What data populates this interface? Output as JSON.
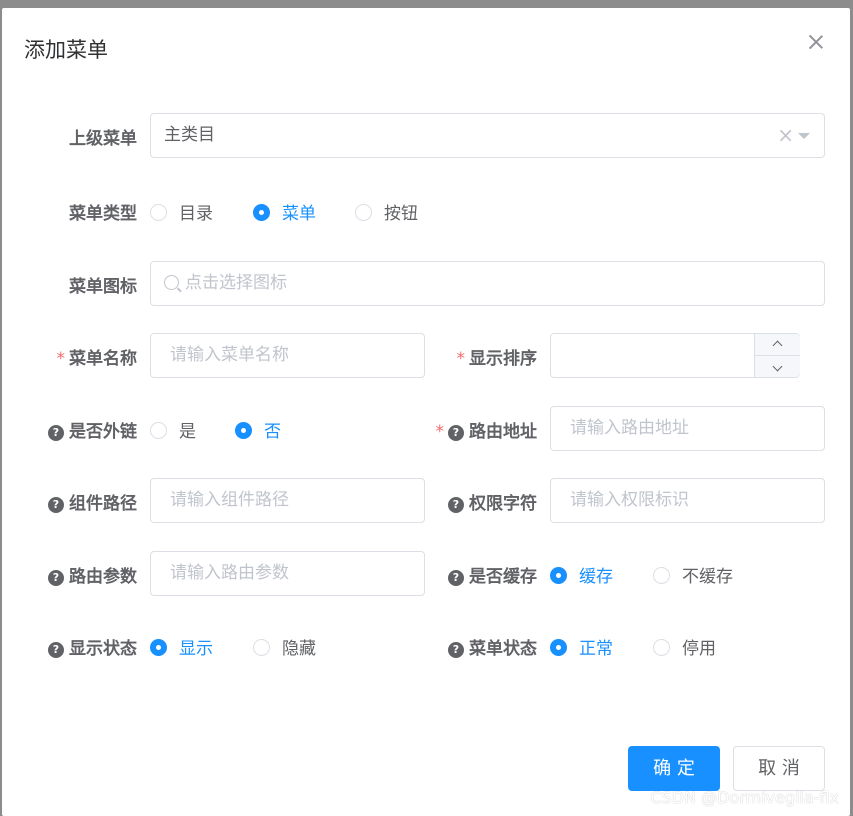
{
  "dialog": {
    "title": "添加菜单"
  },
  "parent_menu": {
    "label": "上级菜单",
    "value": "主类目",
    "clear_icon": "×",
    "arrow_icon": "caret-down"
  },
  "menu_type": {
    "label": "菜单类型",
    "options": [
      "目录",
      "菜单",
      "按钮"
    ],
    "selected": "菜单"
  },
  "menu_icon": {
    "label": "菜单图标",
    "placeholder": "点击选择图标"
  },
  "menu_name": {
    "label": "菜单名称",
    "required": "*",
    "placeholder": "请输入菜单名称"
  },
  "display_order": {
    "label": "显示排序",
    "required": "*",
    "up": "⌃",
    "down": "⌄"
  },
  "external_link": {
    "label": "是否外链",
    "options": [
      "是",
      "否"
    ],
    "selected": "否"
  },
  "route_path": {
    "label": "路由地址",
    "required": "*",
    "placeholder": "请输入路由地址"
  },
  "component_path": {
    "label": "组件路径",
    "placeholder": "请输入组件路径"
  },
  "permission": {
    "label": "权限字符",
    "placeholder": "请输入权限标识"
  },
  "route_params": {
    "label": "路由参数",
    "placeholder": "请输入路由参数"
  },
  "cache": {
    "label": "是否缓存",
    "options": [
      "缓存",
      "不缓存"
    ],
    "selected": "缓存"
  },
  "visible": {
    "label": "显示状态",
    "options": [
      "显示",
      "隐藏"
    ],
    "selected": "显示"
  },
  "status": {
    "label": "菜单状态",
    "options": [
      "正常",
      "停用"
    ],
    "selected": "正常"
  },
  "footer": {
    "confirm": "确 定",
    "cancel": "取 消"
  },
  "help_icon": "?",
  "watermark": "CSDN @Dormiveglia-flx",
  "colors": {
    "primary": "#1890ff",
    "danger": "#f56c6c",
    "text": "#606266",
    "placeholder": "#c0c4cc"
  }
}
